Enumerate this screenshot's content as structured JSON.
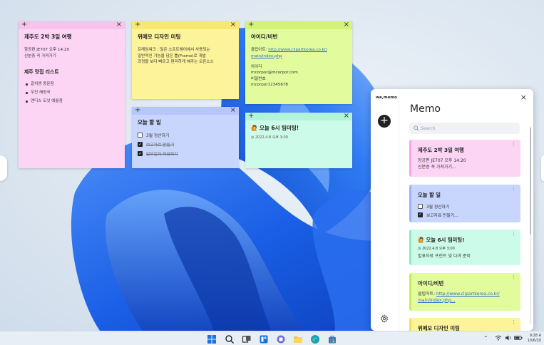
{
  "notes": {
    "jeju": {
      "title": "제주도 2박 3일 여행",
      "lines": [
        "항공편 JE707 오후 14:20",
        "신분증 꼭 가져가기"
      ],
      "subtitle": "제주 맛집 리스트",
      "bullets": [
        "갈치앵 종문점",
        "우진 해장국",
        "맨디스 도넛 애월점"
      ]
    },
    "design": {
      "title": "위메모 디자인 미팅",
      "lines": [
        "프레임워크 : 많은 소프트웨어에서 사용되는",
        "일반적인 기능을 담은 틀(Frame)로 개발",
        "과정을 보다 빠르고 편리하게 해주는 오픈소스"
      ]
    },
    "account": {
      "title": "아이디/비번",
      "link_label": "클립아트:",
      "link_1": "http://www.clipartkorea.co.kr/",
      "link_2": "main/index.php",
      "id_label": "아이디",
      "id_value": "mcorpor@mcorpor.com",
      "pw_label": "비밀번호",
      "pw_value": "mcorpor12345678"
    },
    "todo": {
      "title": "오늘 할 일",
      "items": [
        {
          "label": "3월 정산하기",
          "checked": false
        },
        {
          "label": "보고자료 만들기",
          "checked": true
        },
        {
          "label": "업무일지 작성하기",
          "checked": true
        }
      ]
    },
    "meeting": {
      "title": "오늘 6시 팀미팅!",
      "emoji": "🙋",
      "date": "2022.4.8 오후 3:00"
    }
  },
  "app": {
    "logo": "we,memo",
    "title": "Memo",
    "search_placeholder": "Search",
    "close_label": "×",
    "add_label": "+",
    "cards": {
      "jeju": {
        "title": "제주도 2박 3일 여행",
        "lines": [
          "항공편 JE707 오후 14:20",
          "신분증 꼭 가져가기..."
        ]
      },
      "todo": {
        "title": "오늘 할 일",
        "items": [
          {
            "label": "3월 정산하기",
            "checked": false
          },
          {
            "label": "보고자료 만들기...",
            "checked": true
          }
        ]
      },
      "meeting": {
        "title": "오늘 6시 팀미팅!",
        "emoji": "🙋",
        "date": "2022.4.8 오후 3:00",
        "text": "발표자료 프린트 및 다과 준비"
      },
      "account": {
        "title": "아이디/비번",
        "link_label": "클립아트:",
        "link_1": "http://www.clipartkorea.co.kr/",
        "link_2": "main/index.php..."
      },
      "design": {
        "title": "위메모 디자인 미팅"
      }
    }
  },
  "taskbar": {
    "time": "9:28 A",
    "date": "10/6/20"
  },
  "colors": {
    "pink": "#fcd4f4",
    "yellow": "#fdf39a",
    "green": "#e2fb9c",
    "blue": "#c8d5fc",
    "teal": "#cdfbea",
    "wallpaper_blue": "#1f66e8"
  }
}
